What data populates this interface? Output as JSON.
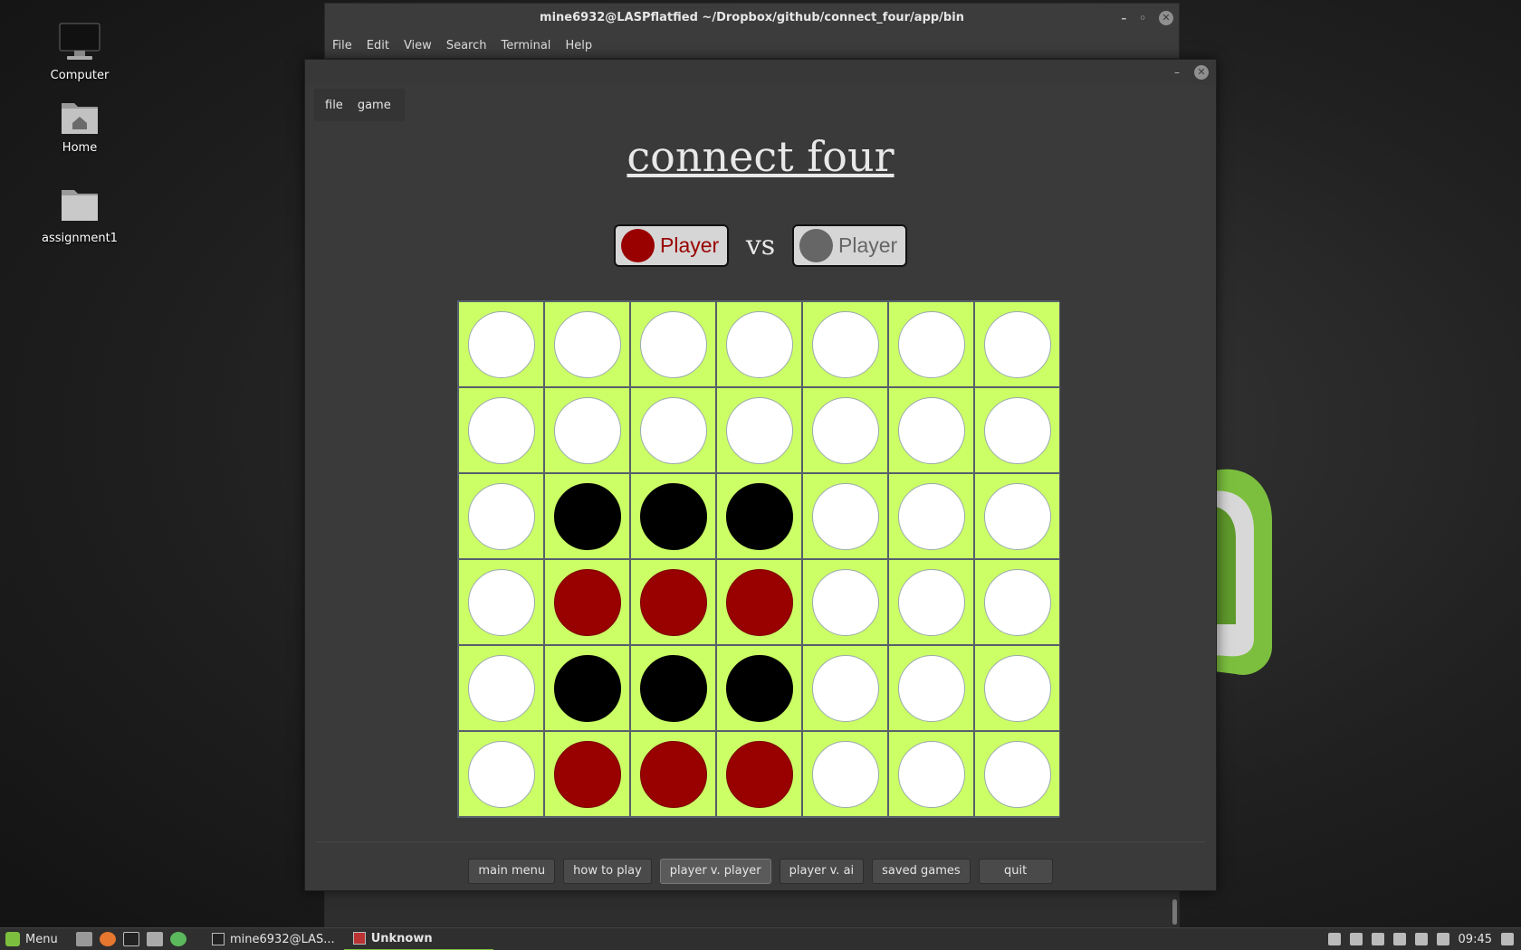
{
  "desktop": {
    "icons": [
      {
        "label": "Computer"
      },
      {
        "label": "Home"
      },
      {
        "label": "assignment1"
      }
    ]
  },
  "terminal": {
    "title": "mine6932@LASPflatfied ~/Dropbox/github/connect_four/app/bin",
    "menu": [
      "File",
      "Edit",
      "View",
      "Search",
      "Terminal",
      "Help"
    ]
  },
  "game": {
    "menu": [
      "file",
      "game"
    ],
    "title": "connect four",
    "player1": {
      "name": "Player",
      "color": "#990000",
      "text_color": "#990000"
    },
    "vs": "vs",
    "player2": {
      "name": "Player",
      "color": "#666666",
      "text_color": "#666666"
    },
    "board": [
      [
        "empty",
        "empty",
        "empty",
        "empty",
        "empty",
        "empty",
        "empty"
      ],
      [
        "empty",
        "empty",
        "empty",
        "empty",
        "empty",
        "empty",
        "empty"
      ],
      [
        "empty",
        "black",
        "black",
        "black",
        "empty",
        "empty",
        "empty"
      ],
      [
        "empty",
        "red",
        "red",
        "red",
        "empty",
        "empty",
        "empty"
      ],
      [
        "empty",
        "black",
        "black",
        "black",
        "empty",
        "empty",
        "empty"
      ],
      [
        "empty",
        "red",
        "red",
        "red",
        "empty",
        "empty",
        "empty"
      ]
    ],
    "colors": {
      "board": "#ccff66",
      "red": "#990000",
      "black": "#000000",
      "empty": "#ffffff"
    },
    "buttons": {
      "main_menu": "main menu",
      "how_to_play": "how to play",
      "pvp": "player v. player",
      "pvai": "player v. ai",
      "saved": "saved games",
      "quit": "quit"
    }
  },
  "taskbar": {
    "menu_label": "Menu",
    "tasks": [
      {
        "label": "mine6932@LAS..."
      },
      {
        "label": "Unknown"
      }
    ],
    "clock": "09:45"
  }
}
